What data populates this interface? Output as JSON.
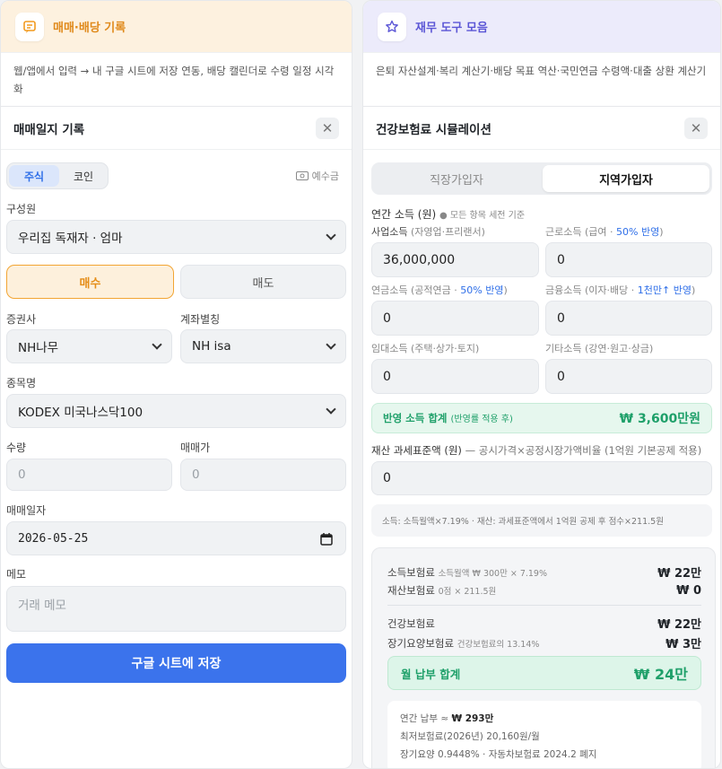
{
  "left": {
    "header_title": "매매·배당 기록",
    "description": "웹/앱에서 입력 → 내 구글 시트에 저장 연동, 배당 캘린더로 수령 일정 시각화",
    "form_title": "매매일지 기록",
    "close_glyph": "✕",
    "asset_tabs": [
      "주식",
      "코인"
    ],
    "cash_label": "예수금",
    "member_label": "구성원",
    "member_value": "우리집 독재자 · 엄마",
    "buy_label": "매수",
    "sell_label": "매도",
    "broker_label": "증권사",
    "broker_value": "NH나무",
    "account_label": "계좌별칭",
    "account_value": "NH isa",
    "ticker_label": "종목명",
    "ticker_value": "KODEX 미국나스닥100",
    "qty_label": "수량",
    "qty_placeholder": "0",
    "price_label": "매매가",
    "price_placeholder": "0",
    "date_label": "매매일자",
    "date_value": "2026-05-25",
    "memo_label": "메모",
    "memo_placeholder": "거래 메모",
    "save_label": "구글 시트에 저장"
  },
  "right": {
    "header_title": "재무 도구 모음",
    "description": "은퇴 자산설계·복리 계산기·배당 목표 역산·국민연금 수령액·대출 상환 계산기",
    "sim_title": "건강보험료 시뮬레이션",
    "close_glyph": "✕",
    "tabs": [
      "직장가입자",
      "지역가입자"
    ],
    "income_heading": "연간 소득 (원)",
    "income_note": "● 모든 항목 세전 기준",
    "biz_label": "사업소득",
    "biz_sub": "(자영업·프리랜서)",
    "biz_value": "36,000,000",
    "work_label": "근로소득",
    "work_sub": "(급여 · ",
    "work_ratio": "50% 반영",
    "work_close": ")",
    "work_value": "0",
    "pension_label": "연금소득",
    "pension_sub": "(공적연금 · ",
    "pension_ratio": "50% 반영",
    "pension_close": ")",
    "pension_value": "0",
    "fin_label": "금융소득",
    "fin_sub": "(이자·배당 · ",
    "fin_ratio": "1천만↑ 반영",
    "fin_close": ")",
    "fin_value": "0",
    "rent_label": "임대소득",
    "rent_sub": "(주택·상가·토지)",
    "rent_value": "0",
    "other_label": "기타소득",
    "other_sub": "(강연·원고·상금)",
    "other_value": "0",
    "sum_label": "반영 소득 합계",
    "sum_sub": "(반영률 적용 후)",
    "sum_value": "₩ 3,600만원",
    "property_heading": "재산 과세표준액 (원)",
    "property_note": "— 공시가격×공정시장가액비율 (1억원 기본공제 적용)",
    "property_value": "0",
    "formula_note": "소득: 소득월액×7.19% · 재산: 과세표준액에서 1억원 공제 후 점수×211.5원",
    "result": {
      "income_ins_label": "소득보험료",
      "income_ins_detail": "소득월액 ₩ 300만 × 7.19%",
      "income_ins_value": "₩ 22만",
      "property_ins_label": "재산보험료",
      "property_ins_detail": "0점 × 211.5원",
      "property_ins_value": "₩ 0",
      "health_label": "건강보험료",
      "health_value": "₩ 22만",
      "ltc_label": "장기요양보험료",
      "ltc_detail": "건강보험료의 13.14%",
      "ltc_value": "₩ 3만",
      "monthly_label": "월 납부 합계",
      "monthly_value": "₩ 24만",
      "annual_label": "연간 납부 ≈ ",
      "annual_value": "₩ 293만",
      "min_ins": "최저보험료(2026년) 20,160원/월",
      "ltc_note": "장기요양 0.9448% · 자동차보험료 2024.2 폐지"
    }
  },
  "colors": {
    "accent_blue": "#3b73ec",
    "accent_orange": "#f29a1f",
    "accent_green": "#1fa06a",
    "left_header_bg": "#fdf1df",
    "right_header_bg": "#ecebfb"
  }
}
